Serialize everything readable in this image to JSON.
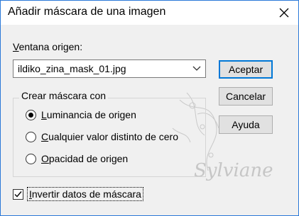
{
  "window": {
    "title": "Añadir máscara de una imagen"
  },
  "source": {
    "label_first": "V",
    "label_rest": "entana origen:",
    "selected": "ildiko_zina_mask_01.jpg"
  },
  "buttons": {
    "ok": "Aceptar",
    "cancel": "Cancelar",
    "help": "Ayuda"
  },
  "group": {
    "title": "Crear máscara con",
    "options": [
      {
        "mnemonic": "L",
        "rest": "uminancia de origen",
        "selected": true
      },
      {
        "mnemonic": "C",
        "rest": "ualquier valor distinto de cero",
        "selected": false
      },
      {
        "mnemonic": "O",
        "rest": "pacidad de origen",
        "selected": false
      }
    ]
  },
  "invert": {
    "mnemonic": "I",
    "rest": "nvertir datos de máscara",
    "checked": true
  },
  "watermark": {
    "text": "Sylviane"
  },
  "icons": [
    "close-icon",
    "chevron-down-icon",
    "checkmark-icon"
  ],
  "colors": {
    "accent": "#0078d7",
    "window_border": "#2b79d8",
    "dialog_bg": "#f0f0f0"
  }
}
